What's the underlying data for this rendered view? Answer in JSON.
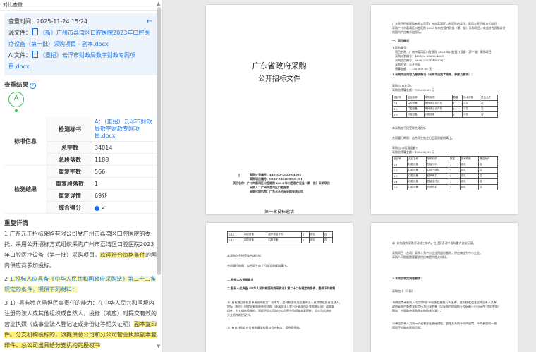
{
  "app": {
    "title": "对比查重"
  },
  "summary": {
    "time_label": "查重时间：",
    "time_value": "2025-11-24 15:24",
    "source_label": "源文件：",
    "source_file": "（新）广州市荔湾区口腔医院2023年口腔医疗设备（第一批）采购项目 - 副本.docx",
    "a_label": "A 文件：",
    "a_file": "（重招）云浮市财政局数字财政专网项目.docx"
  },
  "result": {
    "section_title": "查重结果",
    "grade": "A",
    "rows": [
      {
        "group": "标书信息",
        "key": "检测标书",
        "value": "A：（重招）云浮市财政局数字财政专网项目.docx"
      },
      {
        "group": "",
        "key": "总字数",
        "value": "34014"
      },
      {
        "group": "",
        "key": "总段落数",
        "value": "1188"
      },
      {
        "group": "检测结果",
        "key": "重复字数",
        "value": "566"
      },
      {
        "group": "",
        "key": "重复段落数",
        "value": "1"
      },
      {
        "group": "",
        "key": "重复详情",
        "value": "69处"
      },
      {
        "group": "",
        "key": "综合得分",
        "value": "2"
      }
    ]
  },
  "detail": {
    "section_title": "重复详情",
    "p1_a": "1 广东元正招标采购有限公司受广州市荔湾区口腔医院的委托，采用公开招标方式组织采购广州市荔湾区口腔医院2023年口腔医疗设备（第一批）采购项目。",
    "p1_hl": "欢迎符合资格条件",
    "p1_b": "的国内供应商参加投标。",
    "p2_a": "2 ",
    "p2_hl": "1.投标人应具备《中华人民共和国政府采购法》第二十二条规定的条件，提供下列材料：",
    "p3_a": "3 1）具有独立承担民事责任的能力：在中华人民共和国境内注册的法人或其他组织或自然人，投标（响应）时提交有效的营业执照（或事业法人登记证或身份证等相关证明）",
    "p3_hl": "副本复印件。分支机构投标的，须提供总公司和分公司营业执照副本复印件，总公司出具给分支机构的授权书"
  },
  "doc": {
    "cover_title1": "广东省政府采购",
    "cover_title2": "公开招标文件",
    "info_line1": "采购计划编号：440103-2023-04005",
    "info_line2": "采购项目编号：0836-2302D4004761",
    "info_line3": "项目名称：广州市荔湾区口腔医院 2023 年口腔医疗设备（第一批）采购项目",
    "info_line4": "采购人：广州市荔湾区口腔医院",
    "info_line5": "采购代理机构：广东元正招标采购有限公司",
    "chapter": "第一章投标邀请",
    "p2_head1": "一、项目概况",
    "p2_head2": "1.采购项目内容及需求情况（采购项目技术规格、参数及要求）：",
    "p3_head": "二.投标人的资格要求",
    "p3_head2": "二.投标人应具备《中华人民共和国政府采购法》第二十二条规定的条件，提供下列材料",
    "p4_head": "3.本项目特定资格要求："
  },
  "colors": {
    "accent": "#1a73e8",
    "grade": "#3fb950",
    "highlight": "#fff27a"
  }
}
